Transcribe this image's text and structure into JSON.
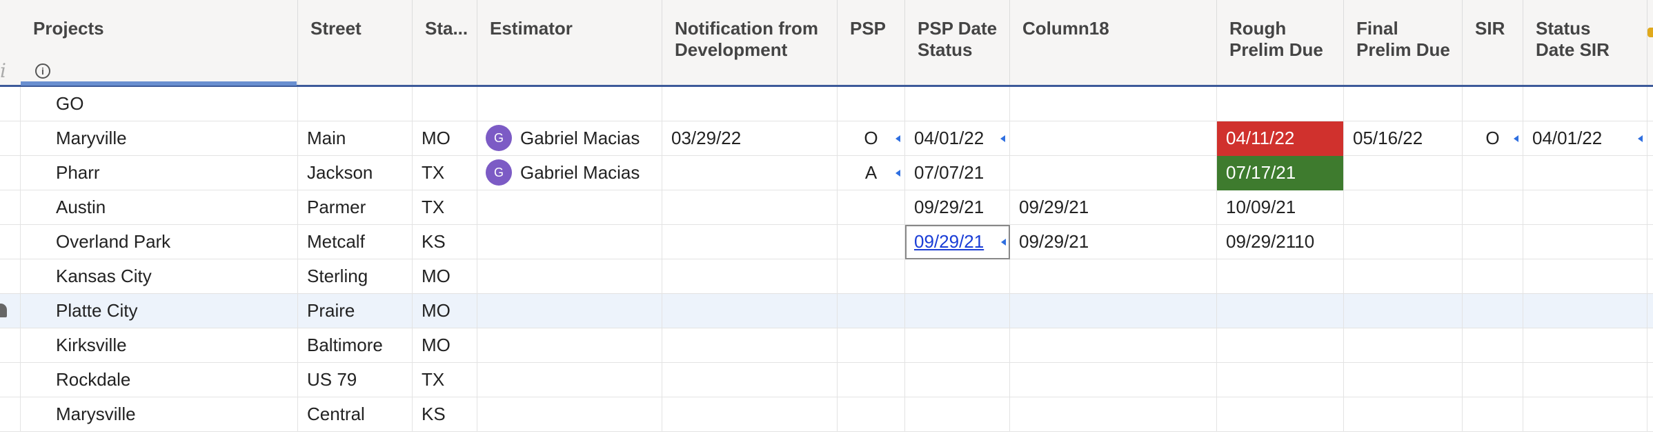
{
  "columns": [
    {
      "label": "Projects"
    },
    {
      "label": "Street"
    },
    {
      "label": "Sta..."
    },
    {
      "label": "Estimator"
    },
    {
      "label": "Notification from\nDevelopment"
    },
    {
      "label": "PSP"
    },
    {
      "label": "PSP Date\nStatus"
    },
    {
      "label": "Column18"
    },
    {
      "label": "Rough\nPrelim Due"
    },
    {
      "label": "Final\nPrelim Due"
    },
    {
      "label": "SIR"
    },
    {
      "label": "Status\nDate SIR"
    }
  ],
  "info_icon": "i",
  "rows": [
    {
      "project": "GO",
      "street": "",
      "state": "",
      "estimator": "",
      "estimator_initial": "",
      "notification": "",
      "psp": "",
      "psp_date": "",
      "column18": "",
      "rough": "",
      "final": "",
      "sir": "",
      "status_date_sir": ""
    },
    {
      "project": "Maryville",
      "street": "Main",
      "state": "MO",
      "estimator": "Gabriel Macias",
      "estimator_initial": "G",
      "notification": "03/29/22",
      "psp": "O",
      "psp_date": "04/01/22",
      "column18": "",
      "rough": "04/11/22",
      "final": "05/16/22",
      "sir": "O",
      "status_date_sir": "04/01/22"
    },
    {
      "project": "Pharr",
      "street": "Jackson",
      "state": "TX",
      "estimator": "Gabriel Macias",
      "estimator_initial": "G",
      "notification": "",
      "psp": "A",
      "psp_date": "07/07/21",
      "column18": "",
      "rough": "07/17/21",
      "final": "",
      "sir": "",
      "status_date_sir": ""
    },
    {
      "project": "Austin",
      "street": "Parmer",
      "state": "TX",
      "estimator": "",
      "estimator_initial": "",
      "notification": "",
      "psp": "",
      "psp_date": "09/29/21",
      "column18": "09/29/21",
      "rough": "10/09/21",
      "final": "",
      "sir": "",
      "status_date_sir": ""
    },
    {
      "project": "Overland Park",
      "street": "Metcalf",
      "state": "KS",
      "estimator": "",
      "estimator_initial": "",
      "notification": "",
      "psp": "",
      "psp_date": "09/29/21",
      "column18": "09/29/21",
      "rough": "09/29/2110",
      "final": "",
      "sir": "",
      "status_date_sir": ""
    },
    {
      "project": "Kansas City",
      "street": "Sterling",
      "state": "MO",
      "estimator": "",
      "estimator_initial": "",
      "notification": "",
      "psp": "",
      "psp_date": "",
      "column18": "",
      "rough": "",
      "final": "",
      "sir": "",
      "status_date_sir": ""
    },
    {
      "project": "Platte City",
      "street": "Praire",
      "state": "MO",
      "estimator": "",
      "estimator_initial": "",
      "notification": "",
      "psp": "",
      "psp_date": "",
      "column18": "",
      "rough": "",
      "final": "",
      "sir": "",
      "status_date_sir": ""
    },
    {
      "project": "Kirksville",
      "street": "Baltimore",
      "state": "MO",
      "estimator": "",
      "estimator_initial": "",
      "notification": "",
      "psp": "",
      "psp_date": "",
      "column18": "",
      "rough": "",
      "final": "",
      "sir": "",
      "status_date_sir": ""
    },
    {
      "project": "Rockdale",
      "street": "US 79",
      "state": "TX",
      "estimator": "",
      "estimator_initial": "",
      "notification": "",
      "psp": "",
      "psp_date": "",
      "column18": "",
      "rough": "",
      "final": "",
      "sir": "",
      "status_date_sir": ""
    },
    {
      "project": "Marysville",
      "street": "Central",
      "state": "KS",
      "estimator": "",
      "estimator_initial": "",
      "notification": "",
      "psp": "",
      "psp_date": "",
      "column18": "",
      "rough": "",
      "final": "",
      "sir": "",
      "status_date_sir": ""
    }
  ],
  "colors": {
    "header_bg": "#f6f5f4",
    "header_rule": "#3d5a99",
    "overdue_red": "#d0312d",
    "done_green": "#3e7b2e",
    "avatar_purple": "#7c5bc5",
    "link_blue": "#1a3dd6",
    "selected_row": "#edf3fb"
  }
}
